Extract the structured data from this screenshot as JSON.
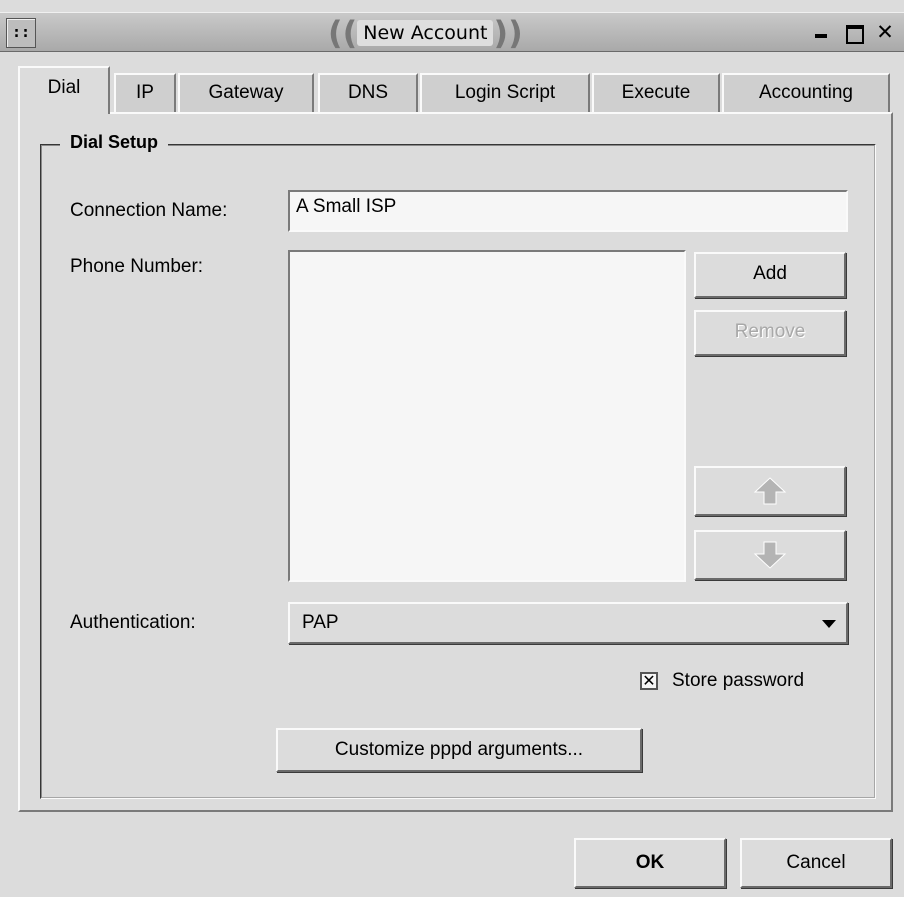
{
  "window": {
    "title": "New Account",
    "menu_glyph": "::",
    "close_glyph": "✕"
  },
  "tabs": [
    {
      "label": "Dial",
      "active": true
    },
    {
      "label": "IP"
    },
    {
      "label": "Gateway"
    },
    {
      "label": "DNS"
    },
    {
      "label": "Login Script"
    },
    {
      "label": "Execute"
    },
    {
      "label": "Accounting"
    }
  ],
  "dial_setup": {
    "title": "Dial Setup",
    "connection_name_label": "Connection Name:",
    "connection_name_value": "A Small ISP",
    "phone_number_label": "Phone Number:",
    "phone_numbers": [],
    "add_label": "Add",
    "remove_label": "Remove",
    "move_up_icon": "up-arrow",
    "move_down_icon": "down-arrow",
    "authentication_label": "Authentication:",
    "authentication_value": "PAP",
    "store_password_label": "Store password",
    "store_password_checked": true,
    "checkbox_glyph": "✕",
    "customize_label": "Customize pppd arguments..."
  },
  "footer": {
    "ok_label": "OK",
    "cancel_label": "Cancel"
  }
}
